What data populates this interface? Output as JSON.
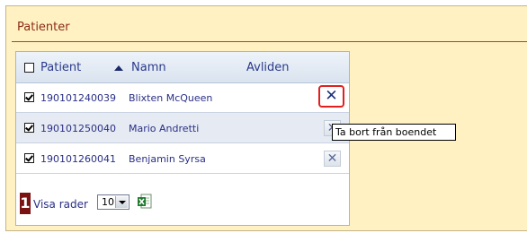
{
  "panel": {
    "title": "Patienter"
  },
  "grid": {
    "columns": [
      "Patient",
      "Namn",
      "Avliden"
    ],
    "sort_icon": "sort-ascending-icon",
    "rows": [
      {
        "checked": true,
        "patient": "190101240039",
        "name": "Blixten McQueen"
      },
      {
        "checked": true,
        "patient": "190101250040",
        "name": "Mario Andretti"
      },
      {
        "checked": true,
        "patient": "190101260041",
        "name": "Benjamin Syrsa"
      }
    ],
    "delete_icon": "close-icon",
    "delete_glyph": "✕"
  },
  "tooltip": {
    "text": "Ta bort från boendet"
  },
  "footer": {
    "page": "1",
    "rows_label": "Visa rader",
    "rows_value": "10",
    "export_icon": "excel-icon"
  },
  "colors": {
    "panel_bg": "#fff1c2",
    "title": "#8a2c16",
    "link": "#2a2f86",
    "highlight": "#e21f1f",
    "page_badge": "#7b1212"
  }
}
